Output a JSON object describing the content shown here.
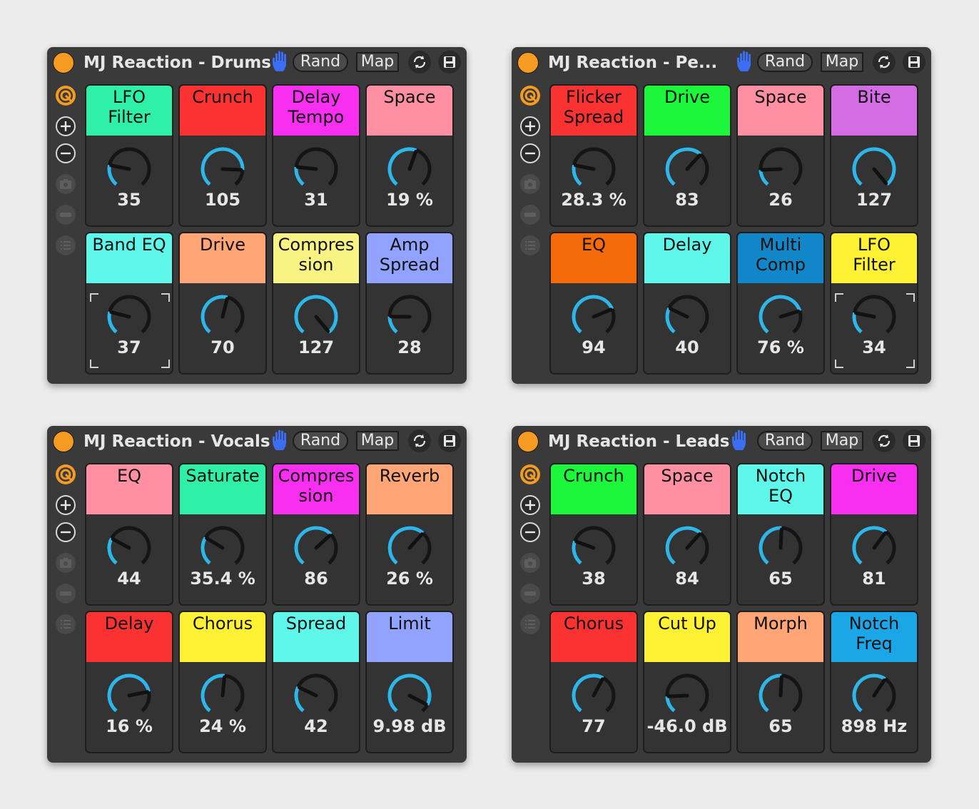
{
  "colors": {
    "device_bg": "#3a3a3a",
    "power": "#f59b22",
    "knob_arc": "#2fb6e8",
    "knob_track": "#151515",
    "hand": "#3b6ef5"
  },
  "devices": [
    {
      "title": "MJ Reaction - Drums",
      "rand_label": "Rand",
      "map_label": "Map",
      "macros": [
        {
          "label": [
            "LFO",
            "Filter"
          ],
          "color": "#2ef0a6",
          "value": "35",
          "fraction": 0.22
        },
        {
          "label": [
            "Crunch"
          ],
          "color": "#fa3232",
          "value": "105",
          "fraction": 0.83
        },
        {
          "label": [
            "Delay",
            "Tempo"
          ],
          "color": "#f82ff0",
          "value": "31",
          "fraction": 0.2
        },
        {
          "label": [
            "Space"
          ],
          "color": "#ff8fa2",
          "value": "19 %",
          "fraction": 0.57
        },
        {
          "label": [
            "Band EQ"
          ],
          "color": "#5ef7ea",
          "value": "37",
          "fraction": 0.23,
          "selected": true
        },
        {
          "label": [
            "Drive"
          ],
          "color": "#ffa576",
          "value": "70",
          "fraction": 0.55
        },
        {
          "label": [
            "Compres",
            "sion"
          ],
          "color": "#f8f383",
          "value": "127",
          "fraction": 1.0
        },
        {
          "label": [
            "Amp",
            "Spread"
          ],
          "color": "#91a3ff",
          "value": "28",
          "fraction": 0.18
        }
      ]
    },
    {
      "title": "MJ Reaction - Pe...",
      "rand_label": "Rand",
      "map_label": "Map",
      "macros": [
        {
          "label": [
            "Flicker",
            "Spread"
          ],
          "color": "#fa3232",
          "value": "28.3 %",
          "fraction": 0.22
        },
        {
          "label": [
            "Drive"
          ],
          "color": "#1cf73b",
          "value": "83",
          "fraction": 0.65
        },
        {
          "label": [
            "Space"
          ],
          "color": "#ff8fa2",
          "value": "26",
          "fraction": 0.17
        },
        {
          "label": [
            "Bite"
          ],
          "color": "#d46ce6",
          "value": "127",
          "fraction": 1.0
        },
        {
          "label": [
            "EQ"
          ],
          "color": "#f56b0a",
          "value": "94",
          "fraction": 0.74
        },
        {
          "label": [
            "Delay"
          ],
          "color": "#5ef7ea",
          "value": "40",
          "fraction": 0.27
        },
        {
          "label": [
            "Multi",
            "Comp"
          ],
          "color": "#1187c9",
          "value": "76 %",
          "fraction": 0.76
        },
        {
          "label": [
            "LFO",
            "Filter"
          ],
          "color": "#fff234",
          "value": "34",
          "fraction": 0.22,
          "selected": true
        }
      ]
    },
    {
      "title": "MJ Reaction - Vocals",
      "rand_label": "Rand",
      "map_label": "Map",
      "macros": [
        {
          "label": [
            "EQ"
          ],
          "color": "#ff8fa2",
          "value": "44",
          "fraction": 0.28
        },
        {
          "label": [
            "Saturate"
          ],
          "color": "#2ef0a6",
          "value": "35.4 %",
          "fraction": 0.29
        },
        {
          "label": [
            "Compres",
            "sion"
          ],
          "color": "#f82ff0",
          "value": "86",
          "fraction": 0.67
        },
        {
          "label": [
            "Reverb"
          ],
          "color": "#ffa576",
          "value": "26 %",
          "fraction": 0.65
        },
        {
          "label": [
            "Delay"
          ],
          "color": "#fa3232",
          "value": "16 %",
          "fraction": 0.78
        },
        {
          "label": [
            "Chorus"
          ],
          "color": "#fff234",
          "value": "24 %",
          "fraction": 0.52
        },
        {
          "label": [
            "Spread"
          ],
          "color": "#5ef7ea",
          "value": "42",
          "fraction": 0.27
        },
        {
          "label": [
            "Limit"
          ],
          "color": "#91a3ff",
          "value": "9.98 dB",
          "fraction": 0.92
        }
      ]
    },
    {
      "title": "MJ Reaction - Leads",
      "rand_label": "Rand",
      "map_label": "Map",
      "macros": [
        {
          "label": [
            "Crunch"
          ],
          "color": "#1cf73b",
          "value": "38",
          "fraction": 0.25
        },
        {
          "label": [
            "Space"
          ],
          "color": "#ff8fa2",
          "value": "84",
          "fraction": 0.65
        },
        {
          "label": [
            "Notch",
            "EQ"
          ],
          "color": "#5ef7ea",
          "value": "65",
          "fraction": 0.51
        },
        {
          "label": [
            "Drive"
          ],
          "color": "#f82ff0",
          "value": "81",
          "fraction": 0.63
        },
        {
          "label": [
            "Chorus"
          ],
          "color": "#fa3232",
          "value": "77",
          "fraction": 0.6
        },
        {
          "label": [
            "Cut Up"
          ],
          "color": "#fff234",
          "value": "-46.0 dB",
          "fraction": 0.17
        },
        {
          "label": [
            "Morph"
          ],
          "color": "#ffa576",
          "value": "65",
          "fraction": 0.51
        },
        {
          "label": [
            "Notch",
            "Freq"
          ],
          "color": "#1ba6e8",
          "value": "898 Hz",
          "fraction": 0.62
        }
      ]
    }
  ]
}
